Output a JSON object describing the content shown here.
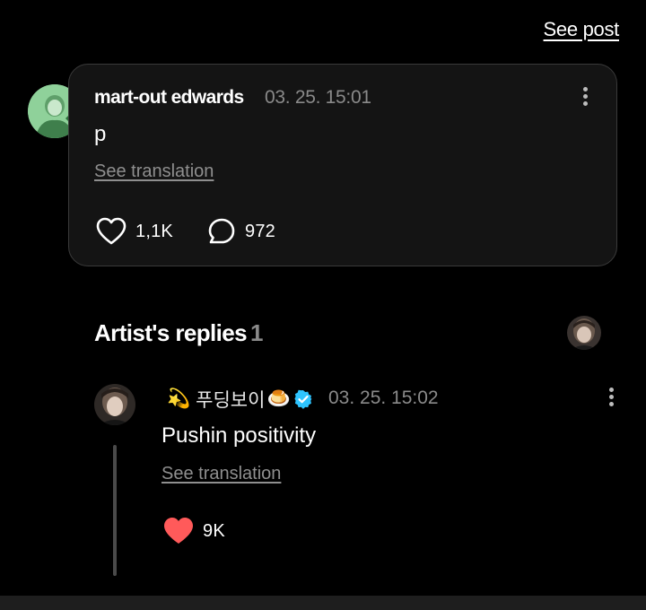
{
  "header": {
    "see_post_label": "See post"
  },
  "post": {
    "author": "mart-out edwards",
    "time": "03. 25. 15:01",
    "body": "p",
    "see_translation": "See translation",
    "likes": "1,1K",
    "comments": "972"
  },
  "artist_replies": {
    "title": "Artist's replies",
    "count": "1"
  },
  "reply": {
    "emoji_prefix": "💫",
    "author": "푸딩보이",
    "emoji_suffix": "🍮",
    "time": "03. 25. 15:02",
    "body": "Pushin positivity",
    "see_translation": "See translation",
    "likes": "9K"
  },
  "colors": {
    "background": "#000000",
    "card": "#141414",
    "muted": "#8a8a8a",
    "heart": "#ff5a5a",
    "verified": "#2ec4ff"
  }
}
